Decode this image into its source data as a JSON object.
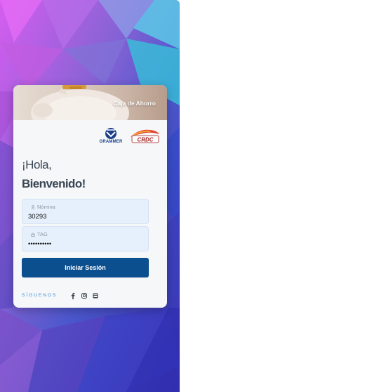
{
  "hero": {
    "title": "Caja de Ahorro"
  },
  "logos": {
    "grammer": "GRAMMER",
    "crdc": "CRDC"
  },
  "greeting": {
    "line1": "¡Hola,",
    "line2": "Bienvenido!"
  },
  "form": {
    "nomina": {
      "label": "Nómina",
      "value": "30293"
    },
    "tag": {
      "label": "TAG",
      "value": "••••••••••"
    },
    "submit_label": "Iniciar Sesión"
  },
  "social": {
    "label": "SÍGUENOS",
    "icons": [
      "facebook-icon",
      "instagram-icon",
      "web-icon"
    ]
  },
  "colors": {
    "button": "#0b4f8e",
    "field": "#e6effc",
    "social": "#3d8ad6"
  }
}
